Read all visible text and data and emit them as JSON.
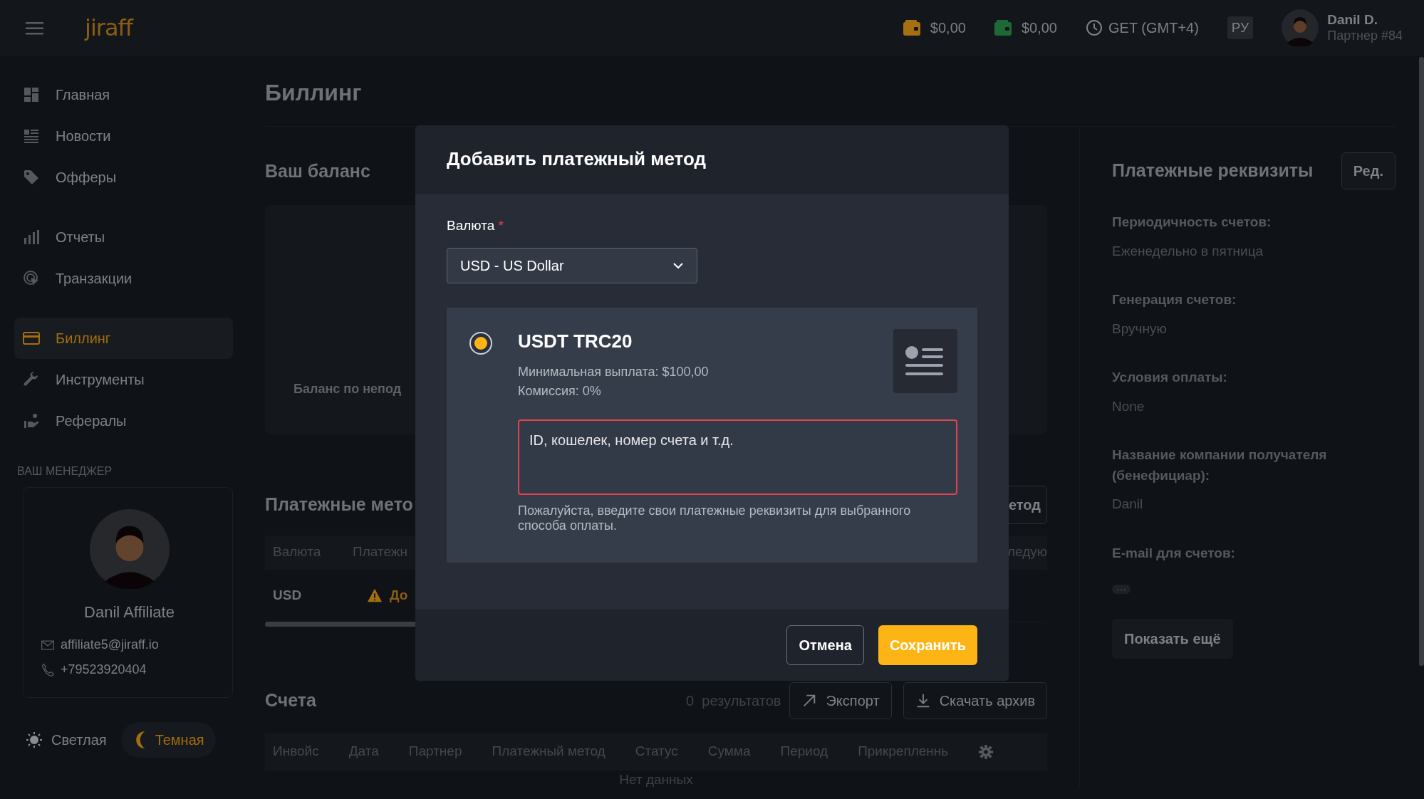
{
  "header": {
    "logo": "jiraff",
    "balances": [
      {
        "amount": "$0,00",
        "color": "#a66f12"
      },
      {
        "amount": "$0,00",
        "color": "#1d6a38"
      }
    ],
    "timezone": "GET (GMT+4)",
    "language": {
      "label": "РУ",
      "active": true
    },
    "user": {
      "name": "Danil D.",
      "subtitle": "Партнер #84"
    }
  },
  "sidebar": {
    "groups": [
      [
        {
          "label": "Главная",
          "selected": false
        },
        {
          "label": "Новости",
          "selected": false
        },
        {
          "label": "Офферы",
          "selected": false
        }
      ],
      [
        {
          "label": "Отчеты",
          "selected": false
        },
        {
          "label": "Транзакции",
          "selected": false
        }
      ],
      [
        {
          "label": "Биллинг",
          "selected": true
        },
        {
          "label": "Инструменты",
          "selected": false
        },
        {
          "label": "Рефералы",
          "selected": false
        }
      ]
    ],
    "manager": {
      "heading": "ВАШ МЕНЕДЖЕР",
      "name": "Danil Affiliate",
      "email": "affiliate5@jiraff.io",
      "phone": "+79523920404"
    },
    "theme_options": [
      {
        "label": "Светлая",
        "selected": false
      },
      {
        "label": "Темная",
        "selected": true
      }
    ]
  },
  "page": {
    "title": "Биллинг",
    "balance": {
      "title": "Ваш баланс",
      "label": "Баланс по непод"
    },
    "payment_methods": {
      "title": "Платежные мето",
      "button": "етод",
      "columns": [
        "Валюта",
        "Платежн",
        "ледую"
      ],
      "rows": [
        {
          "currency": "USD",
          "status": "До"
        }
      ]
    },
    "invoices": {
      "title": "Счета",
      "count": "0",
      "count_label": "результатов",
      "export": "Экспорт",
      "download": "Скачать архив",
      "columns": [
        "Инвойс",
        "Дата",
        "Партнер",
        "Платежный метод",
        "Статус",
        "Сумма",
        "Период",
        "Прикрепленнь"
      ],
      "empty": "Нет данных"
    }
  },
  "details": {
    "title": "Платежные реквизиты",
    "edit": "Ред.",
    "fields": [
      {
        "label": "Периодичность счетов:",
        "value": "Еженедельно в пятница",
        "kind": "text"
      },
      {
        "label": "Генерация счетов:",
        "value": "Вручную",
        "kind": "text"
      },
      {
        "label": "Условия оплаты:",
        "value": "None",
        "kind": "text"
      },
      {
        "label": "Название компании получателя (бенефициар):",
        "value": "Danil",
        "kind": "text"
      },
      {
        "label": "E-mail для счетов:",
        "value": "···",
        "kind": "badge"
      }
    ],
    "show_more": "Показать ещё"
  },
  "modal": {
    "title": "Добавить платежный метод",
    "currency": {
      "label": "Валюта",
      "required_mark": "*",
      "value": "USD - US Dollar"
    },
    "method": {
      "name": "USDT TRC20",
      "selected": true,
      "min_payout": "Минимальная выплата: $100,00",
      "commission": "Комиссия: 0%",
      "placeholder": "ID, кошелек, номер счета и т.д.",
      "invalid": true,
      "hint": "Пожалуйста, введите свои платежные реквизиты для выбранного способа оплаты."
    },
    "cancel": "Отмена",
    "save": "Сохранить"
  }
}
